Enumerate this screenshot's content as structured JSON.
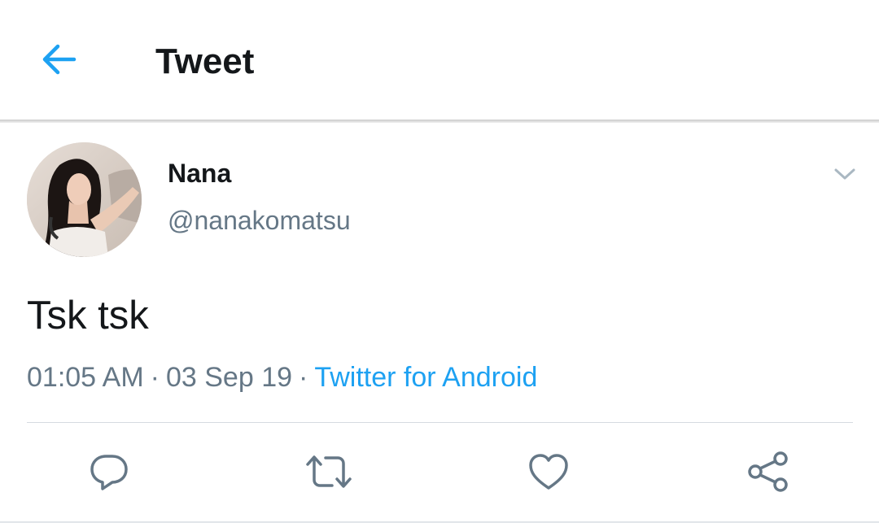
{
  "header": {
    "title": "Tweet",
    "back_icon": "arrow-left-icon"
  },
  "tweet": {
    "display_name": "Nana",
    "handle": "@nanakomatsu",
    "text": "Tsk tsk",
    "time": "01:05 AM",
    "date": "03 Sep 19",
    "separator": "·",
    "source": "Twitter for Android",
    "avatar_icon": "user-avatar",
    "menu_icon": "chevron-down-icon"
  },
  "actions": [
    {
      "name": "reply",
      "icon": "reply-icon"
    },
    {
      "name": "retweet",
      "icon": "retweet-icon"
    },
    {
      "name": "like",
      "icon": "heart-icon"
    },
    {
      "name": "share",
      "icon": "share-icon"
    }
  ],
  "colors": {
    "accent": "#1da1f2",
    "text_primary": "#14171a",
    "text_secondary": "#657786",
    "icon_gray": "#657786"
  }
}
